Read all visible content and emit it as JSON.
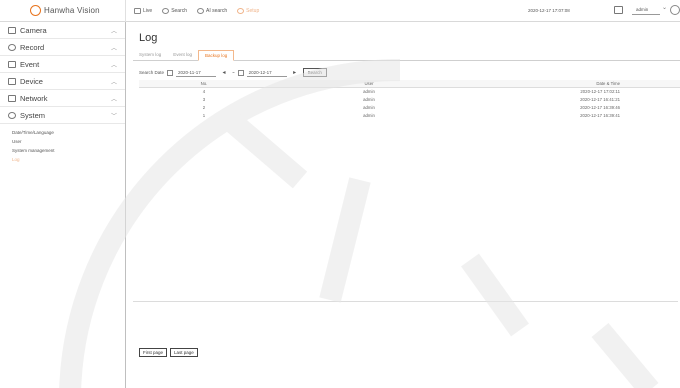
{
  "app": {
    "logo_text": "Hanwha Vision"
  },
  "topbar": {
    "nav": [
      {
        "label": "Live",
        "icon": "monitor-icon"
      },
      {
        "label": "Search",
        "icon": "search-icon"
      },
      {
        "label": "AI search",
        "icon": "ai-search-icon"
      },
      {
        "label": "Setup",
        "icon": "settings-icon",
        "disabled": true
      }
    ],
    "datetime": "2020-12-17 17:07:08",
    "user": "admin"
  },
  "sidebar": {
    "items": [
      {
        "label": "Camera",
        "icon": "camera-icon"
      },
      {
        "label": "Record",
        "icon": "record-icon"
      },
      {
        "label": "Event",
        "icon": "event-icon"
      },
      {
        "label": "Device",
        "icon": "device-icon"
      },
      {
        "label": "Network",
        "icon": "network-icon"
      },
      {
        "label": "System",
        "icon": "gear-icon"
      }
    ],
    "system_submenu": [
      {
        "label": "Date/Time/Language"
      },
      {
        "label": "User"
      },
      {
        "label": "System management"
      },
      {
        "label": "Log",
        "active": true
      }
    ]
  },
  "main": {
    "title": "Log",
    "tabs": [
      {
        "label": "System log"
      },
      {
        "label": "Event log"
      },
      {
        "label": "Backup log",
        "active": true
      }
    ],
    "filter": {
      "label": "Search Date",
      "from": "2020-11-17",
      "to": "2020-12-17",
      "search_button": "Search"
    },
    "table": {
      "headers": [
        "No.",
        "User",
        "Date & Time"
      ],
      "rows": [
        [
          "4",
          "admin",
          "2020-12-17 17:02:11"
        ],
        [
          "3",
          "admin",
          "2020-12-17 16:41:21"
        ],
        [
          "2",
          "admin",
          "2020-12-17 16:39:46"
        ],
        [
          "1",
          "admin",
          "2020-12-17 16:39:41"
        ]
      ]
    },
    "pager": {
      "first": "First page",
      "last": "Last page"
    }
  },
  "colors": {
    "accent": "#e8741e",
    "disabled": "#f0b48a"
  }
}
